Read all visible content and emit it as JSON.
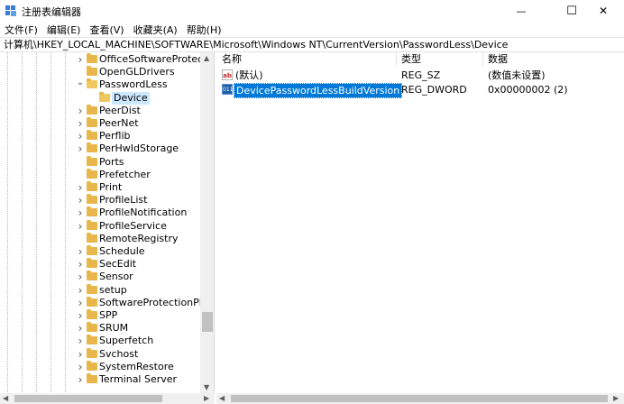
{
  "window": {
    "title": "注册表编辑器",
    "app_icon": "regedit-icon",
    "minimize_glyph": "—",
    "maximize_glyph": "☐",
    "close_glyph": "✕"
  },
  "menu": {
    "items": [
      {
        "label": "文件(F)"
      },
      {
        "label": "编辑(E)"
      },
      {
        "label": "查看(V)"
      },
      {
        "label": "收藏夹(A)"
      },
      {
        "label": "帮助(H)"
      }
    ]
  },
  "address": {
    "path": "计算机\\HKEY_LOCAL_MACHINE\\SOFTWARE\\Microsoft\\Windows NT\\CurrentVersion\\PasswordLess\\Device"
  },
  "tree": {
    "items": [
      {
        "label": "OfficeSoftwareProtectio",
        "state": "collapsed"
      },
      {
        "label": "OpenGLDrivers",
        "state": "leaf"
      },
      {
        "label": "PasswordLess",
        "state": "expanded"
      },
      {
        "label": "Device",
        "state": "selected"
      },
      {
        "label": "PeerDist",
        "state": "collapsed"
      },
      {
        "label": "PeerNet",
        "state": "collapsed"
      },
      {
        "label": "Perflib",
        "state": "collapsed"
      },
      {
        "label": "PerHwIdStorage",
        "state": "collapsed"
      },
      {
        "label": "Ports",
        "state": "leaf"
      },
      {
        "label": "Prefetcher",
        "state": "leaf"
      },
      {
        "label": "Print",
        "state": "collapsed"
      },
      {
        "label": "ProfileList",
        "state": "collapsed"
      },
      {
        "label": "ProfileNotification",
        "state": "collapsed"
      },
      {
        "label": "ProfileService",
        "state": "collapsed"
      },
      {
        "label": "RemoteRegistry",
        "state": "leaf"
      },
      {
        "label": "Schedule",
        "state": "collapsed"
      },
      {
        "label": "SecEdit",
        "state": "collapsed"
      },
      {
        "label": "Sensor",
        "state": "collapsed"
      },
      {
        "label": "setup",
        "state": "collapsed"
      },
      {
        "label": "SoftwareProtectionPlatf",
        "state": "collapsed"
      },
      {
        "label": "SPP",
        "state": "collapsed"
      },
      {
        "label": "SRUM",
        "state": "collapsed"
      },
      {
        "label": "Superfetch",
        "state": "collapsed"
      },
      {
        "label": "Svchost",
        "state": "collapsed"
      },
      {
        "label": "SystemRestore",
        "state": "collapsed"
      },
      {
        "label": "Terminal Server",
        "state": "collapsed"
      }
    ]
  },
  "values": {
    "columns": {
      "name": "名称",
      "type": "类型",
      "data": "数据"
    },
    "rows": [
      {
        "icon": "string-value-icon",
        "icon_glyph": "ab",
        "name": "(默认)",
        "type": "REG_SZ",
        "data": "(数值未设置)",
        "selected": false
      },
      {
        "icon": "binary-value-icon",
        "icon_glyph": "011",
        "name": "DevicePasswordLessBuildVersion",
        "type": "REG_DWORD",
        "data": "0x00000002 (2)",
        "selected": true
      }
    ]
  },
  "colors": {
    "selection": "#0078d7",
    "tree_selection": "#cce8ff",
    "folder": "#e8b64a"
  }
}
